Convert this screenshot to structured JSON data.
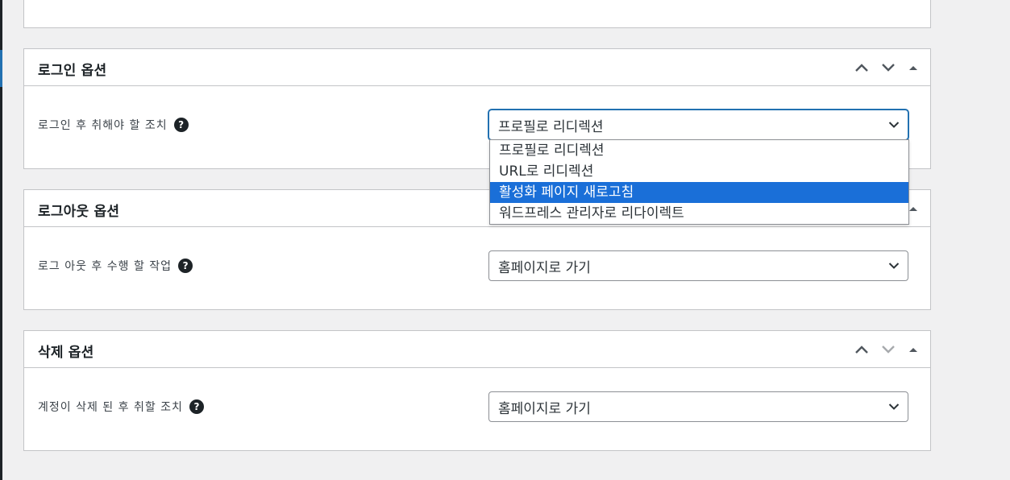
{
  "colors": {
    "background": "#f0f0f1",
    "panel_border": "#c3c4c7",
    "focus_blue": "#2271b1",
    "option_highlight": "#1a6fd8"
  },
  "login_section": {
    "title": "로그인 옵션",
    "label": "로그인 후 취해야 할 조치",
    "help": "?",
    "selected_value": "프로필로 리디렉션",
    "dropdown_open": true,
    "options": [
      {
        "label": "프로필로 리디렉션",
        "highlighted": false
      },
      {
        "label": "URL로 리디렉션",
        "highlighted": false
      },
      {
        "label": "활성화 페이지 새로고침",
        "highlighted": true
      },
      {
        "label": "워드프레스 관리자로 리다이렉트",
        "highlighted": false
      }
    ]
  },
  "logout_section": {
    "title": "로그아웃 옵션",
    "label": "로그 아웃 후 수행 할 작업",
    "help": "?",
    "selected_value": "홈페이지로 가기"
  },
  "delete_section": {
    "title": "삭제 옵션",
    "label": "계정이 삭제 된 후 취할 조치",
    "help": "?",
    "selected_value": "홈페이지로 가기"
  },
  "icons": {
    "move_up": "chevron-up-icon",
    "move_down": "chevron-down-icon",
    "toggle": "triangle-up-icon",
    "select_arrow": "chevron-down-icon",
    "help": "question-circle-icon"
  }
}
